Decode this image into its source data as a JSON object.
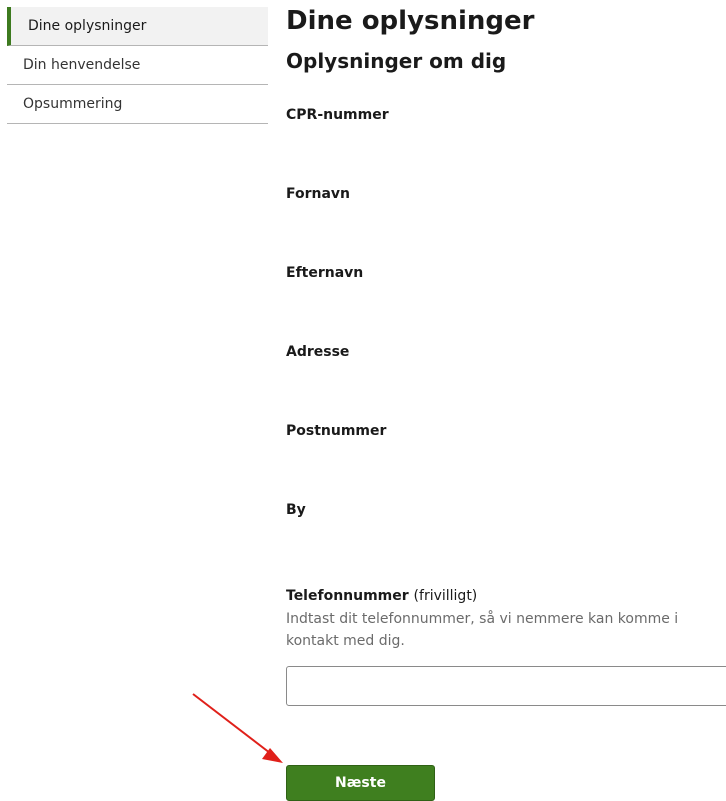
{
  "sidebar": {
    "items": [
      {
        "label": "Dine oplysninger",
        "active": true
      },
      {
        "label": "Din henvendelse",
        "active": false
      },
      {
        "label": "Opsummering",
        "active": false
      }
    ]
  },
  "main": {
    "page_title": "Dine oplysninger",
    "section_title": "Oplysninger om dig",
    "fields": {
      "cpr": "CPR-nummer",
      "fornavn": "Fornavn",
      "efternavn": "Efternavn",
      "adresse": "Adresse",
      "postnummer": "Postnummer",
      "by": "By"
    },
    "phone": {
      "label": "Telefonnummer",
      "optional": "(frivilligt)",
      "help": "Indtast dit telefonnummer, så vi nemmere kan komme i kontakt med dig.",
      "value": ""
    },
    "next_label": "Næste"
  },
  "colors": {
    "accent": "#3f7f1f",
    "annotation_arrow": "#e0201a"
  }
}
